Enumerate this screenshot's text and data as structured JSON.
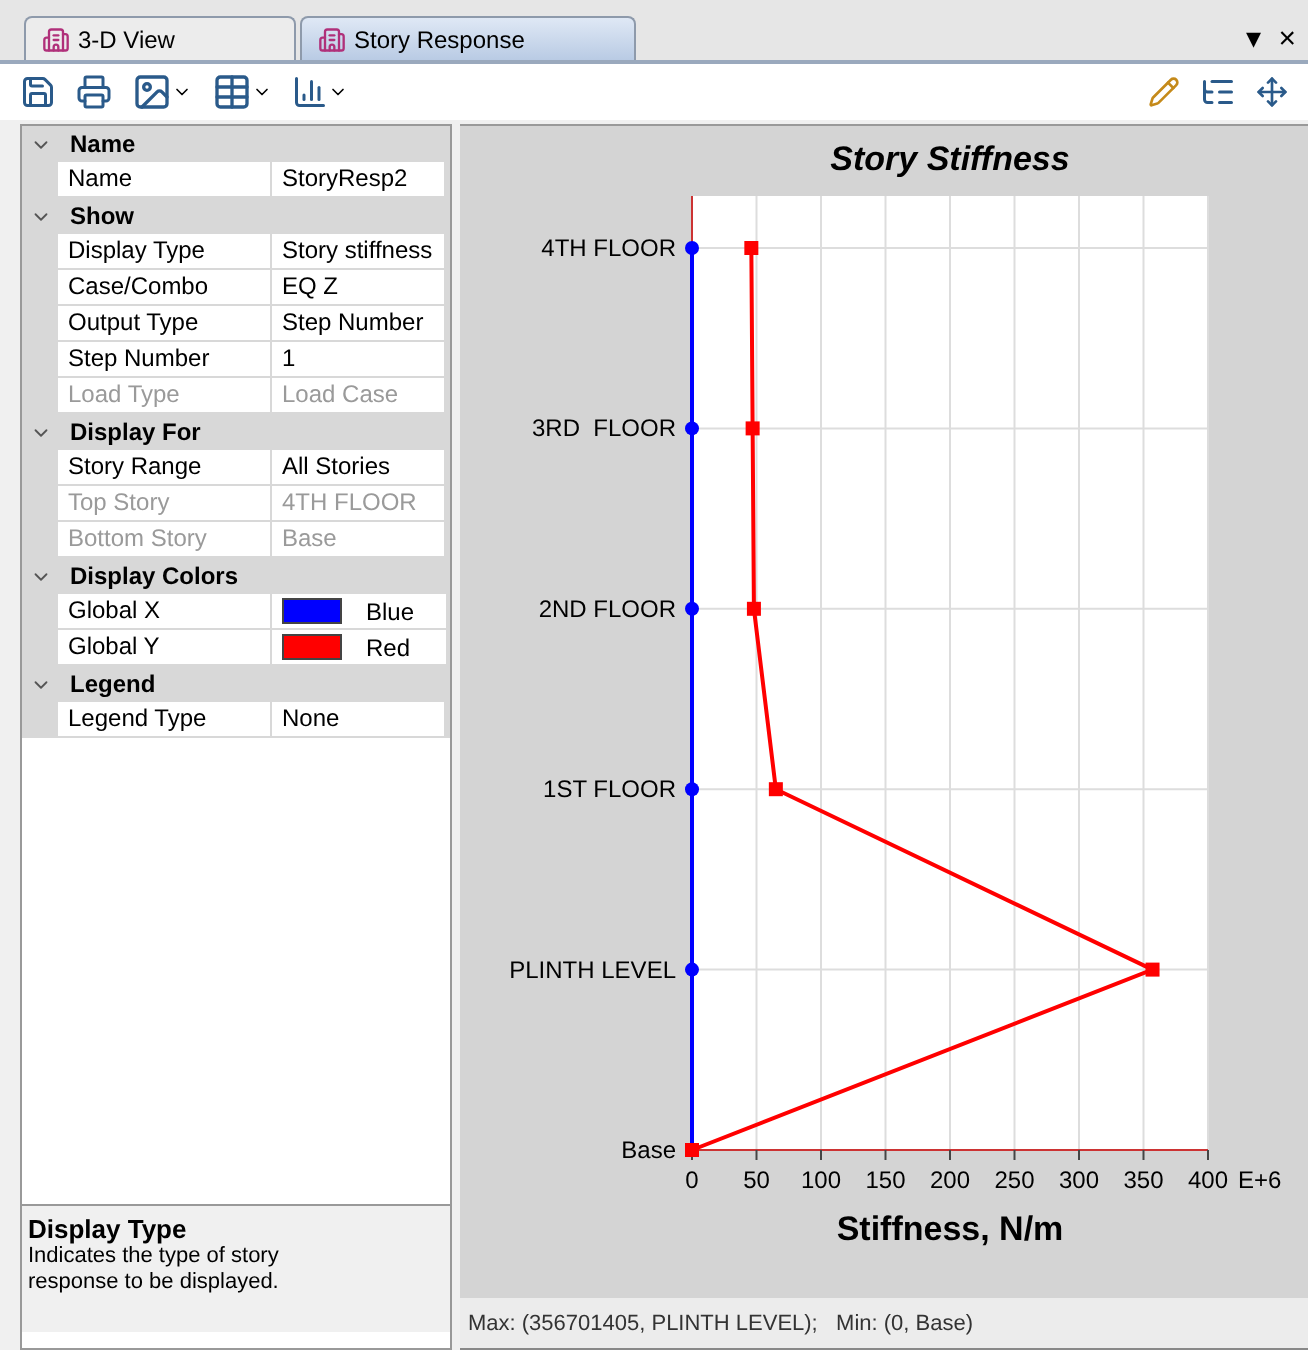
{
  "tabs": [
    {
      "label": "3-D View",
      "selected": false
    },
    {
      "label": "Story Response",
      "selected": true
    }
  ],
  "tab_controls": [
    "▾",
    "×"
  ],
  "properties": [
    {
      "category": "Name",
      "expanded": true,
      "rows": [
        {
          "name": "Name",
          "value": "StoryResp2",
          "disabled": false,
          "kind": "text"
        }
      ]
    },
    {
      "category": "Show",
      "expanded": true,
      "rows": [
        {
          "name": "Display Type",
          "value": "Story stiffness",
          "disabled": false,
          "kind": "text"
        },
        {
          "name": "Case/Combo",
          "value": "EQ Z",
          "disabled": false,
          "kind": "text"
        },
        {
          "name": "Output Type",
          "value": "Step Number",
          "disabled": false,
          "kind": "text"
        },
        {
          "name": "Step Number",
          "value": "1",
          "disabled": false,
          "kind": "text"
        },
        {
          "name": "Load Type",
          "value": "Load Case",
          "disabled": true,
          "kind": "text"
        }
      ]
    },
    {
      "category": "Display For",
      "expanded": true,
      "rows": [
        {
          "name": "Story Range",
          "value": "All Stories",
          "disabled": false,
          "kind": "text"
        },
        {
          "name": "Top Story",
          "value": "4TH FLOOR",
          "disabled": true,
          "kind": "text"
        },
        {
          "name": "Bottom Story",
          "value": "Base",
          "disabled": true,
          "kind": "text"
        }
      ]
    },
    {
      "category": "Display Colors",
      "expanded": true,
      "rows": [
        {
          "name": "Global X",
          "value": "Blue",
          "disabled": false,
          "kind": "color",
          "color": "#0000ff"
        },
        {
          "name": "Global Y",
          "value": "Red",
          "disabled": false,
          "kind": "color",
          "color": "#ff0000"
        }
      ]
    },
    {
      "category": "Legend",
      "expanded": true,
      "rows": [
        {
          "name": "Legend Type",
          "value": "None",
          "disabled": false,
          "kind": "text"
        }
      ]
    }
  ],
  "description": {
    "title": "Display Type",
    "text": "Indicates the type of story response to be displayed."
  },
  "chart": {
    "chart_data": {
      "type": "line",
      "orientation": "horizontal",
      "title": "Story Stiffness",
      "xlabel": "Stiffness, N/m",
      "categories": [
        "4TH FLOOR",
        "3RD  FLOOR",
        "2ND FLOOR",
        "1ST FLOOR",
        "PLINTH LEVEL",
        "Base"
      ],
      "series": [
        {
          "color": "#0000ff",
          "marker": "circle",
          "values": [
            0,
            0,
            0,
            0,
            0,
            0
          ]
        },
        {
          "color": "#ff0000",
          "marker": "square",
          "values": [
            46,
            47,
            48,
            65,
            357,
            0
          ]
        }
      ],
      "grid": true,
      "xlim": [
        0,
        400
      ],
      "xticks": [
        0,
        50,
        100,
        150,
        200,
        250,
        300,
        350,
        400
      ],
      "annotations": [
        {
          "text": "E+6"
        }
      ]
    },
    "status": "Max: (356701405, PLINTH LEVEL);   Min: (0, Base)"
  }
}
